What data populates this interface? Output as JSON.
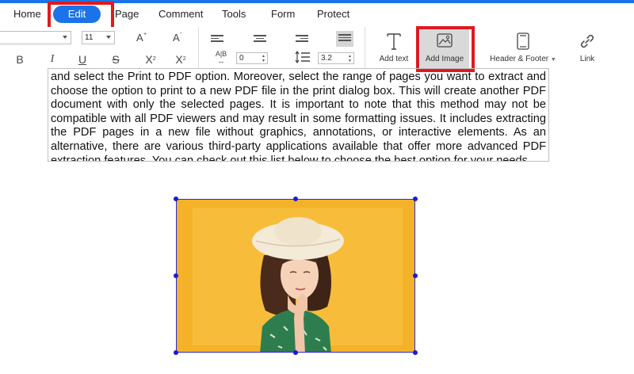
{
  "menu": {
    "items": [
      "Home",
      "Edit",
      "Page",
      "Comment",
      "Tools",
      "Form",
      "Protect"
    ],
    "active": "Edit"
  },
  "toolbar": {
    "font_size": "11",
    "spacing_value": "0",
    "line_spacing_value": "3.2",
    "add_text": "Add text",
    "add_image": "Add Image",
    "header_footer": "Header & Footer",
    "link": "Link",
    "icons": [
      "font-dropdown",
      "increase-font-icon",
      "decrease-font-icon",
      "align-left-icon",
      "align-center-icon",
      "align-right-icon",
      "justify-icon",
      "bold-icon",
      "italic-icon",
      "underline-icon",
      "strikethrough-icon",
      "superscript-icon",
      "subscript-icon",
      "char-spacing-icon",
      "line-spacing-icon"
    ]
  },
  "document": {
    "lines": [
      "and select the Print to PDF option. Moreover, select the range of pages you want to extract and",
      "choose the option to print to a new PDF file in the print dialog box. This will create another PDF",
      "document with only the selected pages. It is important to note that this method may not be",
      "compatible with all PDF viewers and may result in some formatting issues. It includes extracting",
      "the PDF pages in a new file without graphics, annotations, or interactive elements. As an",
      "alternative, there are various third-party applications available that offer more advanced PDF",
      "extraction features. You can check out this list below to choose the best option for your needs."
    ]
  },
  "colors": {
    "accent": "#1a73e8",
    "highlight": "#e0191f",
    "image_bg": "#f4b228",
    "selection": "#1a1ad8"
  }
}
